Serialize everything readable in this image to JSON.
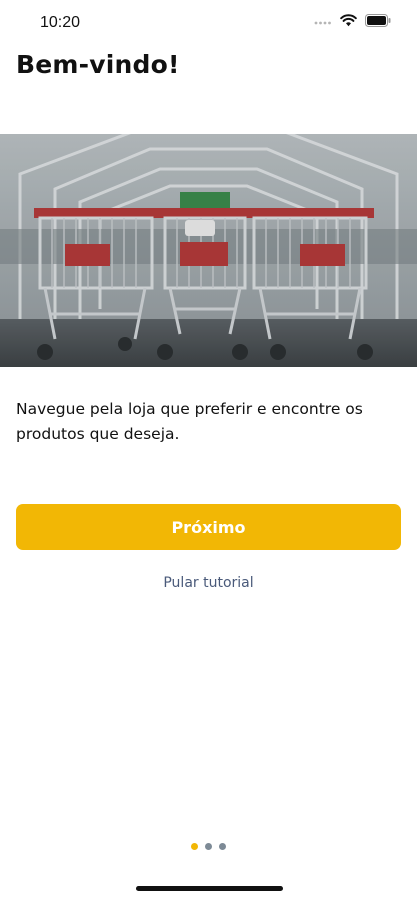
{
  "status_bar": {
    "time": "10:20",
    "icons": [
      "signal-dots-icon",
      "wifi-icon",
      "battery-icon"
    ]
  },
  "page": {
    "title": "Bem-vindo!",
    "hero_image": "shopping-carts-photo",
    "description": "Navegue pela loja que preferir e encontre os produtos que deseja."
  },
  "actions": {
    "next_label": "Próximo",
    "skip_label": "Pular tutorial"
  },
  "pager": {
    "total": 3,
    "active_index": 0
  },
  "colors": {
    "accent": "#F2B705",
    "link": "#4a5a7a",
    "dot_inactive": "#7d8a96"
  }
}
